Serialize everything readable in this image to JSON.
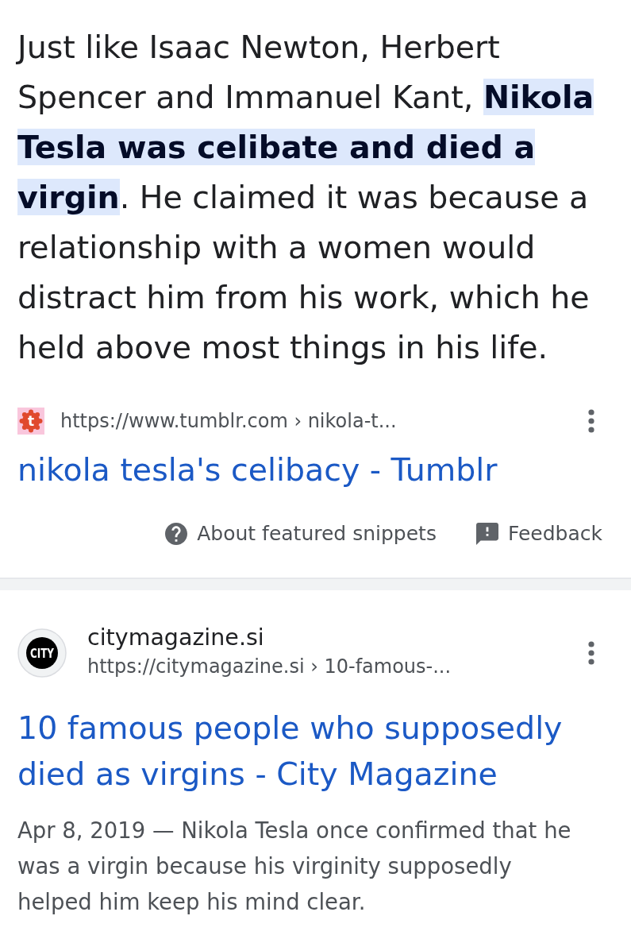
{
  "featured_snippet": {
    "text": "Just like Isaac Newton, Herbert Spencer and Immanuel Kant, **Nikola Tesla was celibate and died a virgin**. He claimed it was because a relationship with a women would distract him from his work, which he held above most things in his life.",
    "source": {
      "favicon_text": "t",
      "url": "https://www.tumblr.com › nikola-t...",
      "title": "nikola tesla's celibacy - Tumblr"
    },
    "footer_links": [
      {
        "kind": "help",
        "label": "About featured snippets"
      },
      {
        "kind": "feedback",
        "label": "Feedback"
      }
    ]
  },
  "results": [
    {
      "logo_text": "CITY",
      "site_name": "citymagazine.si",
      "url": "https://citymagazine.si › 10-famous-...",
      "title": "10 famous people who supposedly died as virgins - City Magazine",
      "snippet": "Apr 8, 2019 — Nikola Tesla once confirmed that he was a virgin because his virginity supposedly helped him keep his mind clear."
    }
  ]
}
